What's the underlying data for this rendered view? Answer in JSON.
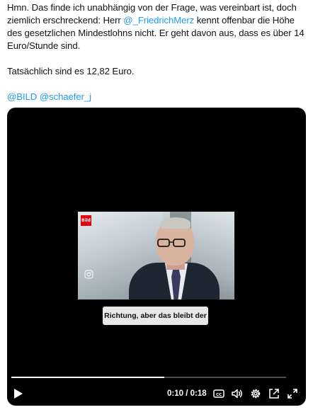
{
  "tweet": {
    "line1": "Hmn. Das finde ich unabhängig von der Frage, was vereinbart ist, doch",
    "line2_pre": "ziemlich erschreckend: Herr ",
    "line2_mention": "@_FriedrichMerz",
    "line2_post": " kennt offenbar die Höhe",
    "line3": "des gesetzlichen Mindestlohns nicht. Er geht davon aus, dass es über 14",
    "line4": "Euro/Stunde sind.",
    "line5": "Tatsächlich sind es 12,82 Euro.",
    "mention1": "@BILD",
    "mention2": "@schaefer_j"
  },
  "video": {
    "logo": "Bild",
    "subtitle": "Richtung, aber das bleibt der",
    "time": "0:10 / 0:18",
    "progress": 0.556,
    "icons": [
      "play-icon",
      "captions-icon",
      "volume-icon",
      "settings-icon",
      "popout-icon",
      "fullscreen-icon"
    ]
  },
  "colors": {
    "link": "#1d9bf0",
    "video_bg": "#000000",
    "text": "#0f1419"
  }
}
